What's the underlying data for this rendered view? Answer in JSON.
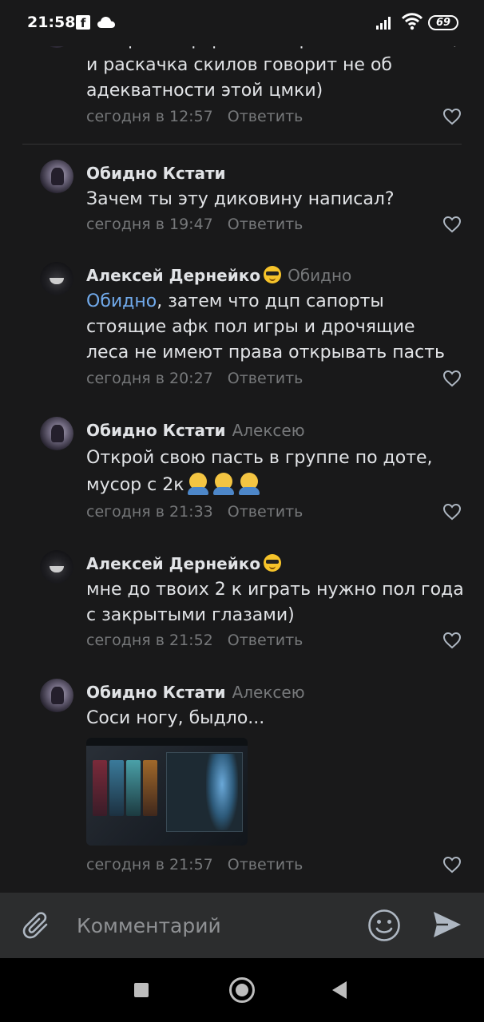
{
  "status_bar": {
    "time": "21:58",
    "battery": "69"
  },
  "comments": [
    {
      "author": "",
      "reply_to": "",
      "lines": [
        "все фигня форс и нейтральная шмотка,",
        "и раскачка скилов говорит не об",
        "адекватности этой цмки)"
      ],
      "time": "сегодня в 12:57",
      "reply_label": "Ответить"
    },
    {
      "author": "Обидно Кстати",
      "reply_to": "",
      "lines": [
        "Зачем ты эту диковину написал?"
      ],
      "time": "сегодня в 19:47",
      "reply_label": "Ответить"
    },
    {
      "author": "Алексей Дернейко",
      "reply_to": "Обидно",
      "mention": "Обидно",
      "lines": [
        ", затем что дцп сапорты",
        "стоящие афк пол игры и дрочящие",
        "леса не имеют права открывать пасть"
      ],
      "time": "сегодня в 20:27",
      "reply_label": "Ответить"
    },
    {
      "author": "Обидно Кстати",
      "reply_to": "Алексею",
      "lines": [
        "Открой свою пасть в группе по доте,",
        "мусор с 2к"
      ],
      "time": "сегодня в 21:33",
      "reply_label": "Ответить"
    },
    {
      "author": "Алексей Дернейко",
      "reply_to": "",
      "lines": [
        "мне до твоих 2 к играть нужно пол года",
        "с закрытыми глазами)"
      ],
      "time": "сегодня в 21:52",
      "reply_label": "Ответить"
    },
    {
      "author": "Обидно Кстати",
      "reply_to": "Алексею",
      "lines": [
        "Соси ногу, быдло..."
      ],
      "time": "сегодня в 21:57",
      "reply_label": "Ответить"
    }
  ],
  "input": {
    "placeholder": "Комментарий"
  },
  "colors": {
    "background": "#19191a",
    "link": "#71aaeb",
    "muted": "#76787a",
    "input_bar": "#2c2d2e"
  }
}
